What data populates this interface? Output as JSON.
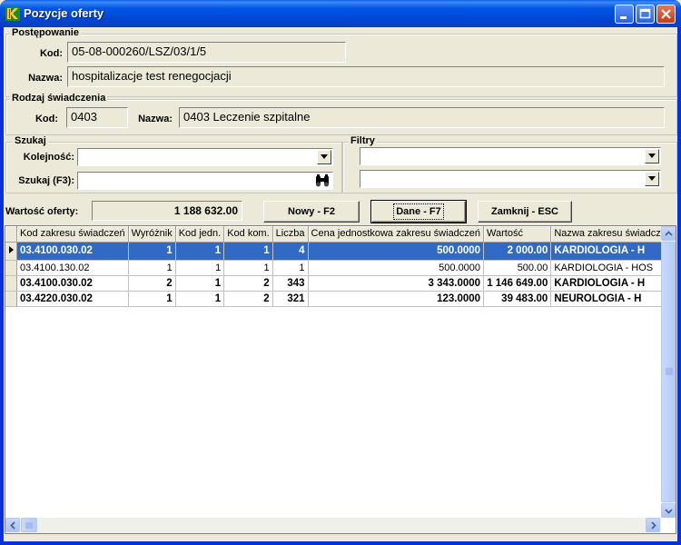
{
  "window": {
    "title": "Pozycje oferty",
    "icon": "app-logo-icon"
  },
  "postepowanie": {
    "group_label": "Postępowanie",
    "kod_label": "Kod:",
    "kod_value": "05-08-000260/LSZ/03/1/5",
    "nazwa_label": "Nazwa:",
    "nazwa_value": "hospitalizacje test renegocjacji"
  },
  "rodzaj": {
    "group_label": "Rodzaj świadczenia",
    "kod_label": "Kod:",
    "kod_value": "0403",
    "nazwa_label": "Nazwa:",
    "nazwa_value": "0403 Leczenie szpitalne"
  },
  "szukaj": {
    "group_label": "Szukaj",
    "kolejnosc_label": "Kolejność:",
    "kolejnosc_value": "",
    "szukaj_label": "Szukaj (F3):",
    "szukaj_value": "",
    "search_icon": "binoculars-icon"
  },
  "filtry": {
    "group_label": "Filtry",
    "filter1_value": "",
    "filter2_value": ""
  },
  "wartosc": {
    "label": "Wartość oferty:",
    "value": "1 188 632.00"
  },
  "buttons": {
    "nowy": "Nowy - F2",
    "dane": "Dane - F7",
    "zamknij": "Zamknij - ESC"
  },
  "table": {
    "columns": [
      "Kod zakresu świadczeń",
      "Wyróżnik",
      "Kod jedn.",
      "Kod kom.",
      "Liczba",
      "Cena jednostkowa zakresu świadczeń",
      "Wartość",
      "Nazwa zakresu świadczeń"
    ],
    "rows": [
      [
        "03.4100.030.02",
        "1",
        "1",
        "1",
        "4",
        "500.0000",
        "2 000.00",
        "KARDIOLOGIA - H"
      ],
      [
        "03.4100.130.02",
        "1",
        "1",
        "1",
        "1",
        "500.0000",
        "500.00",
        "KARDIOLOGIA - HOS"
      ],
      [
        "03.4100.030.02",
        "2",
        "1",
        "2",
        "343",
        "3 343.0000",
        "1 146 649.00",
        "KARDIOLOGIA - H"
      ],
      [
        "03.4220.030.02",
        "1",
        "1",
        "2",
        "321",
        "123.0000",
        "39 483.00",
        "NEUROLOGIA - H"
      ]
    ],
    "selected_row": 0,
    "bold_rows": [
      0,
      2,
      3
    ]
  },
  "colors": {
    "titlebar": "#0055e5",
    "selection": "#316ac5",
    "face": "#ece9d8"
  }
}
